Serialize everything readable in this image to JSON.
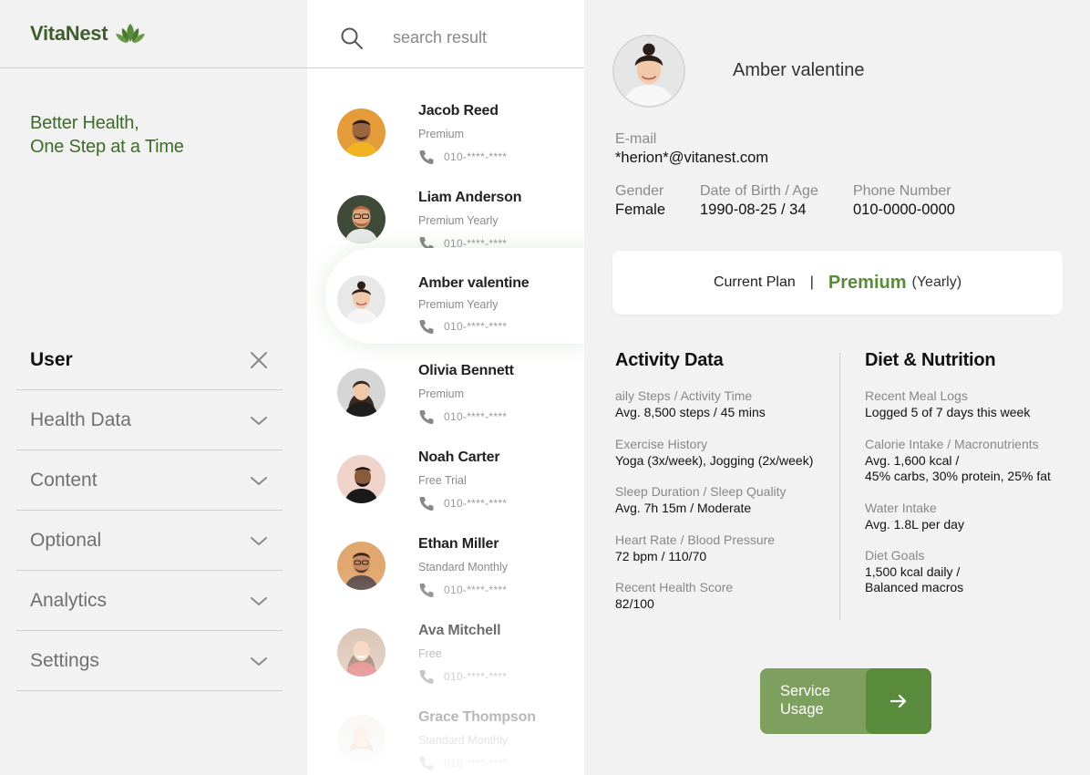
{
  "brand": {
    "name": "VitaNest"
  },
  "tagline": {
    "line1": "Better Health,",
    "line2": "One Step at a Time"
  },
  "menu": {
    "items": [
      {
        "label": "User",
        "icon": "close-icon",
        "active": true
      },
      {
        "label": "Health Data",
        "icon": "chevron-down-icon"
      },
      {
        "label": "Content",
        "icon": "chevron-down-icon"
      },
      {
        "label": "Optional",
        "icon": "chevron-down-icon"
      },
      {
        "label": "Analytics",
        "icon": "chevron-down-icon"
      },
      {
        "label": "Settings",
        "icon": "chevron-down-icon"
      }
    ]
  },
  "search": {
    "placeholder": "search result"
  },
  "members": [
    {
      "name": "Jacob Reed",
      "plan": "Premium",
      "phone": "010-****-****"
    },
    {
      "name": "Liam Anderson",
      "plan": "Premium Yearly",
      "phone": "010-****-****"
    },
    {
      "name": "Amber valentine",
      "plan": "Premium Yearly",
      "phone": "010-****-****",
      "selected": true
    },
    {
      "name": "Olivia Bennett",
      "plan": "Premium",
      "phone": "010-****-****"
    },
    {
      "name": "Noah Carter",
      "plan": "Free Trial",
      "phone": "010-****-****"
    },
    {
      "name": "Ethan Miller",
      "plan": "Standard Monthly",
      "phone": "010-****-****"
    },
    {
      "name": "Ava Mitchell",
      "plan": "Free",
      "phone": "010-****-****"
    },
    {
      "name": "Grace Thompson",
      "plan": "Standard Monthly",
      "phone": "010-****-****"
    }
  ],
  "profile": {
    "name": "Amber valentine",
    "email_label": "E-mail",
    "email": "*herion*@vitanest.com",
    "gender_label": "Gender",
    "gender": "Female",
    "dob_label": "Date of Birth / Age",
    "dob": "1990-08-25 / 34",
    "phone_label": "Phone Number",
    "phone": "010-0000-0000"
  },
  "plan": {
    "label": "Current Plan",
    "separator": "|",
    "name": "Premium",
    "period": "(Yearly)"
  },
  "activity": {
    "title": "Activity Data",
    "items": [
      {
        "label": "aily Steps / Activity Time",
        "value": "Avg. 8,500 steps / 45 mins"
      },
      {
        "label": "Exercise History",
        "value": "Yoga (3x/week), Jogging (2x/week)"
      },
      {
        "label": "Sleep Duration / Sleep Quality",
        "value": "Avg. 7h 15m / Moderate"
      },
      {
        "label": "Heart Rate / Blood Pressure",
        "value": "72 bpm / 110/70"
      },
      {
        "label": "Recent Health Score",
        "value": "82/100"
      }
    ]
  },
  "diet": {
    "title": "Diet & Nutrition",
    "items": [
      {
        "label": "Recent Meal Logs",
        "value": "Logged 5 of 7 days this week"
      },
      {
        "label": "Calorie Intake / Macronutrients",
        "value": "Avg. 1,600 kcal /\n45% carbs, 30% protein, 25% fat"
      },
      {
        "label": "Water Intake",
        "value": "Avg. 1.8L per day"
      },
      {
        "label": "Diet Goals",
        "value": "1,500 kcal daily /\n Balanced macros"
      }
    ]
  },
  "service_button": {
    "label": "Service Usage",
    "icon": "arrow-right-icon"
  },
  "colors": {
    "brand_green": "#3f5f2a",
    "accent_green": "#5a8a3c",
    "button_green": "#7ea05f",
    "background": "#f2f2f2"
  }
}
